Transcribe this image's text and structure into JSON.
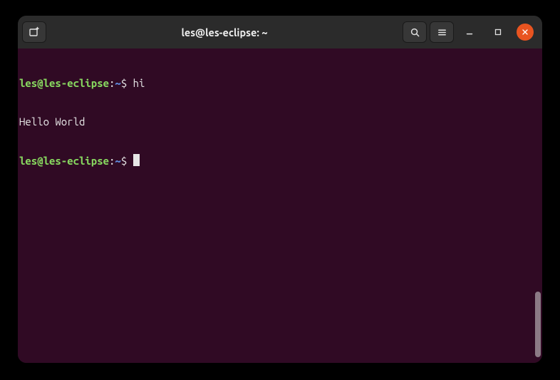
{
  "window": {
    "title": "les@les-eclipse: ~"
  },
  "terminal": {
    "lines": [
      {
        "user_host": "les@les-eclipse",
        "colon": ":",
        "path": "~",
        "dollar": "$",
        "command": "hi"
      },
      {
        "output": "Hello World"
      },
      {
        "user_host": "les@les-eclipse",
        "colon": ":",
        "path": "~",
        "dollar": "$",
        "command": ""
      }
    ]
  },
  "colors": {
    "terminal_bg": "#300a24",
    "titlebar_bg": "#2b2b2b",
    "close_btn": "#e95420",
    "prompt_green": "#87d75f",
    "prompt_blue": "#5f87d7",
    "text": "#e6e6e6"
  },
  "icons": {
    "new_tab": "new-tab-icon",
    "search": "search-icon",
    "menu": "hamburger-icon",
    "minimize": "minimize-icon",
    "maximize": "maximize-icon",
    "close": "close-icon"
  }
}
